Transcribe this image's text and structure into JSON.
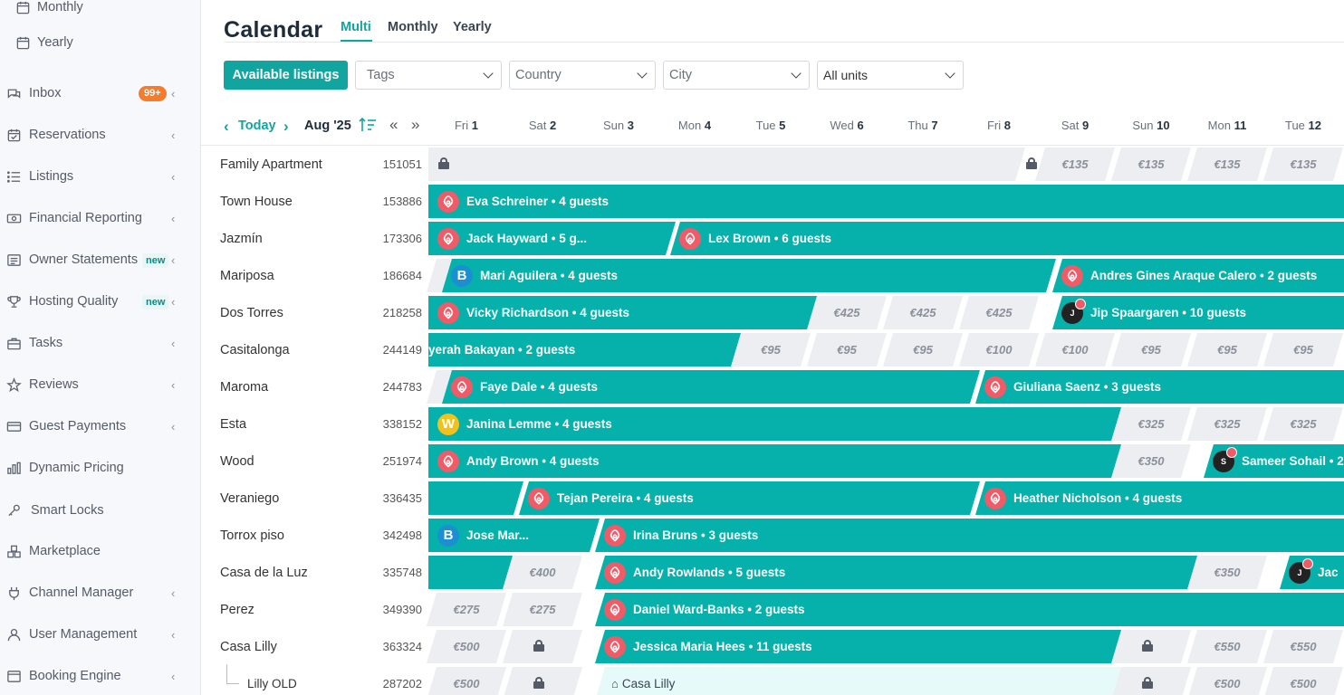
{
  "sidebar": {
    "items": [
      {
        "label": "Monthly",
        "icon": "calendar-icon",
        "sub": true
      },
      {
        "label": "Yearly",
        "icon": "calendar-icon",
        "sub": true
      },
      {
        "label": "Inbox",
        "icon": "chat-icon",
        "badge": "99+"
      },
      {
        "label": "Reservations",
        "icon": "calendar-check-icon"
      },
      {
        "label": "Listings",
        "icon": "list-icon"
      },
      {
        "label": "Financial Reporting",
        "icon": "money-icon"
      },
      {
        "label": "Owner Statements",
        "icon": "statement-icon",
        "new": "new"
      },
      {
        "label": "Hosting Quality",
        "icon": "trophy-icon",
        "new": "new"
      },
      {
        "label": "Tasks",
        "icon": "briefcase-icon"
      },
      {
        "label": "Reviews",
        "icon": "star-icon"
      },
      {
        "label": "Guest Payments",
        "icon": "card-icon"
      },
      {
        "label": "Dynamic Pricing",
        "icon": "bar-chart-icon"
      },
      {
        "label": "Smart Locks",
        "icon": "key-icon"
      },
      {
        "label": "Marketplace",
        "icon": "blocks-icon"
      },
      {
        "label": "Channel Manager",
        "icon": "plug-icon"
      },
      {
        "label": "User Management",
        "icon": "user-icon"
      },
      {
        "label": "Booking Engine",
        "icon": "browser-icon"
      }
    ]
  },
  "header": {
    "title": "Calendar",
    "tabs": [
      "Multi",
      "Monthly",
      "Yearly"
    ],
    "active_tab": "Multi"
  },
  "filters": {
    "available_listings": "Available listings",
    "tags": "Tags",
    "country": "Country",
    "city": "City",
    "units": "All units"
  },
  "date_nav": {
    "today": "Today",
    "month": "Aug '25"
  },
  "days": [
    {
      "dow": "Fri",
      "d": "1"
    },
    {
      "dow": "Sat",
      "d": "2"
    },
    {
      "dow": "Sun",
      "d": "3"
    },
    {
      "dow": "Mon",
      "d": "4"
    },
    {
      "dow": "Tue",
      "d": "5"
    },
    {
      "dow": "Wed",
      "d": "6"
    },
    {
      "dow": "Thu",
      "d": "7"
    },
    {
      "dow": "Fri",
      "d": "8"
    },
    {
      "dow": "Sat",
      "d": "9"
    },
    {
      "dow": "Sun",
      "d": "10"
    },
    {
      "dow": "Mon",
      "d": "11"
    },
    {
      "dow": "Tue",
      "d": "12"
    }
  ],
  "listings": [
    {
      "name": "Family Apartment",
      "id": "151051"
    },
    {
      "name": "Town House",
      "id": "153886"
    },
    {
      "name": "Jazmín",
      "id": "173306"
    },
    {
      "name": "Mariposa",
      "id": "186684"
    },
    {
      "name": "Dos Torres",
      "id": "218258"
    },
    {
      "name": "Casitalonga",
      "id": "244149"
    },
    {
      "name": "Maroma",
      "id": "244783"
    },
    {
      "name": "Esta",
      "id": "338152"
    },
    {
      "name": "Wood",
      "id": "251974"
    },
    {
      "name": "Veraniego",
      "id": "336435"
    },
    {
      "name": "Torrox piso",
      "id": "342498"
    },
    {
      "name": "Casa de la Luz",
      "id": "335748"
    },
    {
      "name": "Perez",
      "id": "349390"
    },
    {
      "name": "Casa Lilly",
      "id": "363324"
    },
    {
      "name": "Lilly OLD",
      "id": "287202",
      "child": true
    }
  ],
  "bookings": [
    {
      "row": 1,
      "guest": "Eva Schreiner • 4 guests",
      "channel": "airbnb"
    },
    {
      "row": 2,
      "guest": "Jack Hayward • 5 g...",
      "channel": "airbnb"
    },
    {
      "row": 2,
      "guest": "Lex Brown • 6 guests",
      "channel": "airbnb"
    },
    {
      "row": 3,
      "guest": "Mari Aguilera • 4 guests",
      "channel": "booking",
      "avatar": "B"
    },
    {
      "row": 3,
      "guest": "Andres Gines Araque Calero • 2 guests",
      "channel": "airbnb"
    },
    {
      "row": 4,
      "guest": "Vicky Richardson • 4 guests",
      "channel": "airbnb"
    },
    {
      "row": 4,
      "guest": "Jip Spaargaren • 10 guests",
      "channel": "user",
      "avatar": "J"
    },
    {
      "row": 5,
      "guest": "yerah Bakayan • 2 guests",
      "channel": "none"
    },
    {
      "row": 6,
      "guest": "Faye Dale • 4 guests",
      "channel": "airbnb"
    },
    {
      "row": 6,
      "guest": "Giuliana Saenz • 3 guests",
      "channel": "airbnb"
    },
    {
      "row": 7,
      "guest": "Janina Lemme • 4 guests",
      "channel": "website",
      "avatar": "W"
    },
    {
      "row": 8,
      "guest": "Andy Brown • 4 guests",
      "channel": "airbnb"
    },
    {
      "row": 8,
      "guest": "Sameer Sohail • 2",
      "channel": "user",
      "avatar": "S"
    },
    {
      "row": 9,
      "guest": "",
      "channel": "none"
    },
    {
      "row": 9,
      "guest": "Tejan Pereira • 4 guests",
      "channel": "airbnb"
    },
    {
      "row": 9,
      "guest": "Heather Nicholson • 4 guests",
      "channel": "airbnb"
    },
    {
      "row": 10,
      "guest": "Jose Mar...",
      "channel": "booking",
      "avatar": "B"
    },
    {
      "row": 10,
      "guest": "Irina Bruns • 3 guests",
      "channel": "airbnb"
    },
    {
      "row": 11,
      "guest": "",
      "channel": "none"
    },
    {
      "row": 11,
      "guest": "Andy Rowlands • 5 guests",
      "channel": "airbnb"
    },
    {
      "row": 11,
      "guest": "Jac",
      "channel": "user",
      "avatar": "J"
    },
    {
      "row": 12,
      "guest": "Daniel Ward-Banks • 2 guests",
      "channel": "airbnb"
    },
    {
      "row": 13,
      "guest": "Jessica Maria Hees • 11 guests",
      "channel": "airbnb"
    }
  ],
  "prices": {
    "r0": [
      "€135",
      "€135",
      "€135",
      "€135"
    ],
    "r4": [
      "€425",
      "€425",
      "€425"
    ],
    "r5": [
      "€95",
      "€95",
      "€95",
      "€100",
      "€100",
      "€95",
      "€95",
      "€95"
    ],
    "r7": [
      "€325",
      "€325",
      "€325"
    ],
    "r8": [
      "€350"
    ],
    "r11": [
      "€400",
      "€350"
    ],
    "r12": [
      "€275",
      "€275"
    ],
    "r13": [
      "€500",
      "€550",
      "€550"
    ],
    "r14": [
      "€500",
      "€500",
      "€500"
    ]
  },
  "blocked_label": "Casa Lilly"
}
